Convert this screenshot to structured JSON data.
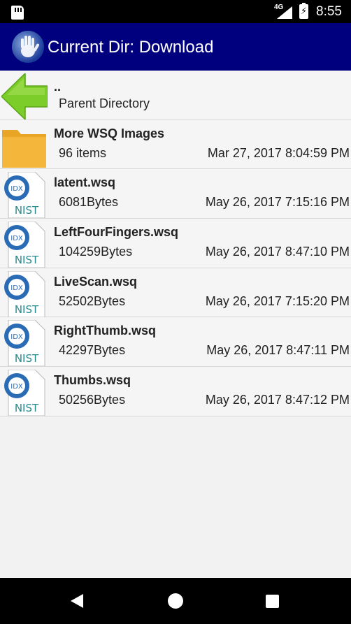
{
  "status_bar": {
    "network": "4G",
    "time": "8:55"
  },
  "app_bar": {
    "title": "Current Dir: Download",
    "logo_icon": "hand-print-icon"
  },
  "files": [
    {
      "name": "..",
      "detail": "Parent Directory",
      "date": "",
      "icon": "back-arrow-icon"
    },
    {
      "name": "More WSQ Images",
      "detail": "96 items",
      "date": "Mar 27, 2017 8:04:59 PM",
      "icon": "folder-icon"
    },
    {
      "name": "latent.wsq",
      "detail": "6081Bytes",
      "date": "May 26, 2017 7:15:16 PM",
      "icon": "nist-file-icon"
    },
    {
      "name": "LeftFourFingers.wsq",
      "detail": "104259Bytes",
      "date": "May 26, 2017 8:47:10 PM",
      "icon": "nist-file-icon"
    },
    {
      "name": "LiveScan.wsq",
      "detail": "52502Bytes",
      "date": "May 26, 2017 7:15:20 PM",
      "icon": "nist-file-icon"
    },
    {
      "name": "RightThumb.wsq",
      "detail": "42297Bytes",
      "date": "May 26, 2017 8:47:11 PM",
      "icon": "nist-file-icon"
    },
    {
      "name": "Thumbs.wsq",
      "detail": "50256Bytes",
      "date": "May 26, 2017 8:47:12 PM",
      "icon": "nist-file-icon"
    }
  ],
  "nist_icon": {
    "top_text": "IDX",
    "bottom_text": "NIST"
  },
  "colors": {
    "app_bar": "#00007f",
    "back_arrow": "#7ccc2a",
    "folder": "#f4b73c",
    "nist_blue": "#2a6bb5",
    "nist_teal": "#2a8a8f"
  }
}
